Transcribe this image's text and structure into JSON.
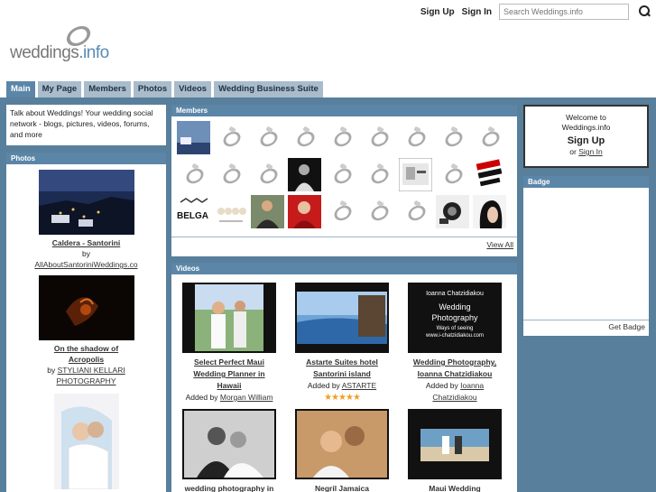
{
  "header": {
    "logo_text": "weddings",
    "logo_suffix": ".info",
    "signup": "Sign Up",
    "signin": "Sign In",
    "search_placeholder": "Search Weddings.info"
  },
  "tabs": [
    "Main",
    "My Page",
    "Members",
    "Photos",
    "Videos",
    "Wedding Business Suite"
  ],
  "about": {
    "text": "Talk about Weddings! Your wedding social network - blogs, pictures, videos, forums, and more"
  },
  "photos": {
    "heading": "Photos",
    "items": [
      {
        "title": "Caldera - Santorini",
        "by": "by",
        "author": "AllAboutSantoriniWeddings.co"
      },
      {
        "title_line1": "On the shadow of",
        "title_line2": "Acropolis",
        "by": "by",
        "author_line1": "STYLIANI KELLARI",
        "author_line2": "PHOTOGRAPHY"
      }
    ]
  },
  "members": {
    "heading": "Members",
    "view_all": "View All",
    "belga_text": "BELGA"
  },
  "videos": {
    "heading": "Videos",
    "items": [
      {
        "t1": "Select Perfect Maui",
        "t2": "Wedding Planner in",
        "t3": "Hawaii",
        "added": "Added by",
        "author": "Morgan William"
      },
      {
        "t1": "Astarte Suites hotel",
        "t2": "Santorini island",
        "added": "Added by",
        "author": "ASTARTE",
        "stars": "★★★★★"
      },
      {
        "t1": "Wedding Photography,",
        "t2": "Ioanna Chatzidiakou",
        "added": "Added by",
        "author": "Ioanna",
        "author2": "Chatzidiakou",
        "thumb_l1": "Ioanna Chatzidiakou",
        "thumb_l2": "Wedding",
        "thumb_l3": "Photography",
        "thumb_l4": "Ways of seeing",
        "thumb_l5": "www.i-chatzidiakou.com"
      },
      {
        "t1": "wedding photography in"
      },
      {
        "t1": "Negril Jamaica"
      },
      {
        "t1": "Maui Wedding"
      }
    ]
  },
  "welcome": {
    "line1": "Welcome to",
    "line2": "Weddings.info",
    "signup": "Sign Up",
    "or": "or",
    "signin": "Sign In"
  },
  "badge": {
    "heading": "Badge",
    "get_badge": "Get Badge"
  },
  "colors": {
    "frame": "#587f9c",
    "tab_active": "#5b86a8",
    "tab": "#a9bccb",
    "star": "#f0a020"
  }
}
